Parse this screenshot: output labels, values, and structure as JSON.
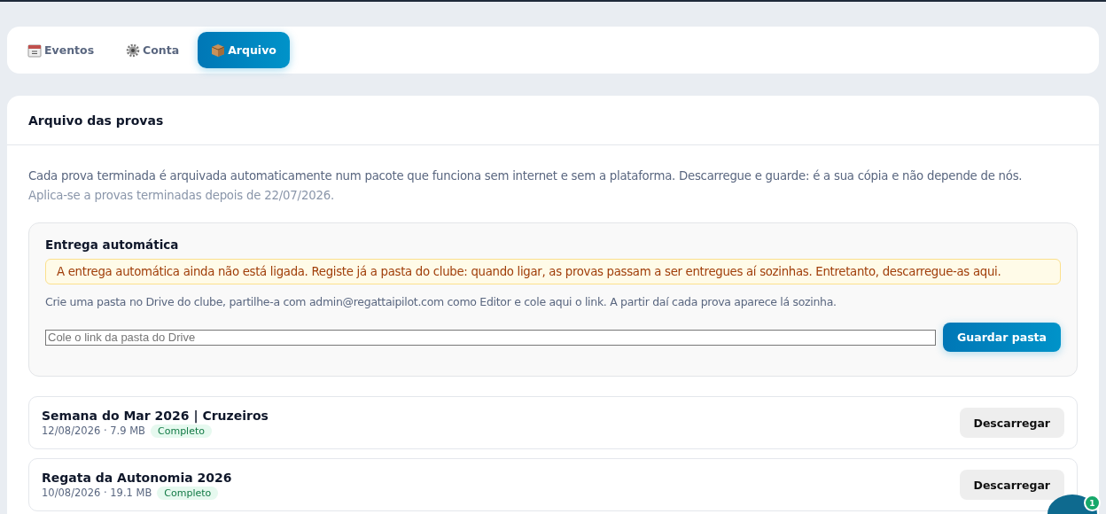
{
  "tabs": [
    {
      "kind": "calendar",
      "label": "Eventos",
      "selected": false
    },
    {
      "kind": "gear",
      "label": "Conta",
      "selected": false
    },
    {
      "kind": "package",
      "label": "Arquivo",
      "selected": true
    }
  ],
  "archive": {
    "title": "Arquivo das provas",
    "description": "Cada prova terminada é arquivada automaticamente num pacote que funciona sem internet e sem a plataforma. Descarregue e guarde: é a sua cópia e não depende de nós.",
    "note": "Aplica-se a provas terminadas depois de 22/07/2026.",
    "auto_delivery": {
      "title": "Entrega automática",
      "warning": "A entrega automática ainda não está ligada. Registe já a pasta do clube: quando ligar, as provas passam a ser entregues aí sozinhas. Entretanto, descarregue-as aqui.",
      "instructions": "Crie uma pasta no Drive do clube, partilhe-a com admin@regattaipilot.com como Editor e cole aqui o link. A partir daí cada prova aparece lá sozinha.",
      "placeholder": "Cole o link da pasta do Drive",
      "button": "Guardar pasta"
    },
    "items": [
      {
        "name": "Semana do Mar 2026 | Cruzeiros",
        "meta": "12/08/2026 · 7.9 MB",
        "status": "Completo",
        "button": "Descarregar"
      },
      {
        "name": "Regata da Autonomia 2026",
        "meta": "10/08/2026 · 19.1 MB",
        "status": "Completo",
        "button": "Descarregar"
      }
    ]
  },
  "chat": {
    "badge": "1"
  }
}
